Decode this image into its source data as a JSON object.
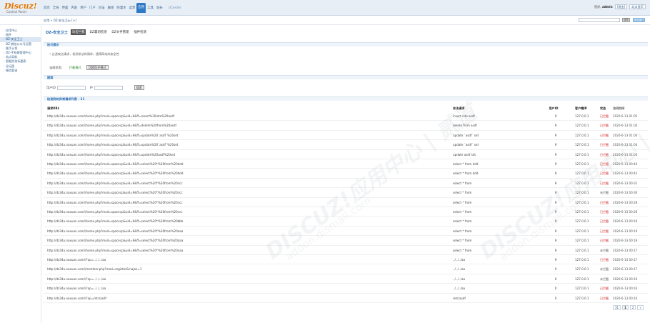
{
  "logo": {
    "main": "Discuz!",
    "sub": "Control Panel"
  },
  "nav": [
    "首页",
    "全局",
    "界面",
    "内容",
    "用户",
    "门户",
    "论坛",
    "群组",
    "防灌水",
    "运营",
    "应用",
    "工具",
    "站长",
    "UCenter"
  ],
  "nav_active_index": 10,
  "user": {
    "prefix": "您好,",
    "name": "admin",
    "logout": "[退出]",
    "home": "站点首页"
  },
  "breadcrumb": "应用 » DZ-安全卫士 [+]",
  "search": {
    "button": "搜索",
    "chip": "常用操作"
  },
  "sidebar": [
    "应用中心",
    "插件",
    "DZ-安全卫士",
    "DZ-微信公众号运营",
    "顺手认领",
    "DZ-手机微管理中心",
    "站点导航",
    "智能防伪标题表",
    "论坛图",
    "微信登录"
  ],
  "sidebar_active_index": 2,
  "page_title": "DZ-安全卫士",
  "tabs": [
    "攻击拦截",
    "DZ漏洞检测",
    "DZ文件管理",
    "插件检测"
  ],
  "tab_active_index": 0,
  "tips": {
    "header": "技巧提示",
    "text": "过滤攻击请求，检测非法的请求，提高网站的安全性"
  },
  "mode": {
    "label": "当前状态：",
    "value": "拦截模式",
    "button": "切换防护模式"
  },
  "filter": {
    "header": "搜索",
    "uid_label": "用户ID",
    "ip_label": "IP",
    "button": "搜索"
  },
  "list_header": "检测到的异常请求列表 - 31",
  "columns": {
    "url": "请求URL",
    "str": "非法请求",
    "uid": "用户ID",
    "ip": "客户端IP",
    "status": "状态",
    "time": "访问时间"
  },
  "rows": [
    {
      "url": "http://dz34u.naxuan.com//home.php?mod=spacecp&uid=9&ff=insert%20into%20asdf",
      "str": "insert into asdf",
      "uid": "9",
      "ip": "127.0.0.1",
      "status": "已拦截",
      "blocked": true,
      "time": "2020-6-13 01:05"
    },
    {
      "url": "http://dz34u.naxuan.com//home.php?mod=spacecp&uid=9&ff=delete%20from%20asdf",
      "str": "delete from asdf",
      "uid": "9",
      "ip": "127.0.0.1",
      "status": "已拦截",
      "blocked": true,
      "time": "2020-6-13 01:04"
    },
    {
      "url": "http://dz34u.naxuan.com//home.php?mod=spacecp&uid=9&ff=update%20`asdf`%20set",
      "str": "update `asdf` set",
      "uid": "9",
      "ip": "127.0.0.1",
      "status": "已拦截",
      "blocked": true,
      "time": "2020-6-13 01:04"
    },
    {
      "url": "http://dz34u.naxuan.com//home.php?mod=spacecp&uid=9&ff=update%20`asdf`%20set",
      "str": "update `asdf` set",
      "uid": "9",
      "ip": "127.0.0.1",
      "status": "已拦截",
      "blocked": true,
      "time": "2020-6-13 01:04"
    },
    {
      "url": "http://dz34u.naxuan.com//home.php?mod=spacecp&uid=9&ff=update%20asdf%20set",
      "str": "update asdf set",
      "uid": "9",
      "ip": "127.0.0.1",
      "status": "已拦截",
      "blocked": true,
      "time": "2020-6-13 01:04"
    },
    {
      "url": "http://dz34u.naxuan.com//home.php?mod=spacecp&uid=9&ff=select%20*%20from%20ddd",
      "str": "select * from ddd",
      "uid": "9",
      "ip": "127.0.0.1",
      "status": "已拦截",
      "blocked": true,
      "time": "2020-6-13 00:44"
    },
    {
      "url": "http://dz34u.naxuan.com//home.php?mod=spacecp&uid=9&ff=select%20*%20from%20ddd",
      "str": "select * from ddd",
      "uid": "9",
      "ip": "127.0.0.1",
      "status": "已拦截",
      "blocked": true,
      "time": "2020-6-13 00:43"
    },
    {
      "url": "http://dz34u.naxuan.com//home.php?mod=spacecp&uid=9&ff=select%20*%20from%20ccc",
      "str": "select * from",
      "uid": "9",
      "ip": "127.0.0.1",
      "status": "已拦截",
      "blocked": true,
      "time": "2020-6-13 00:31"
    },
    {
      "url": "http://dz34u.naxuan.com//home.php?mod=spacecp&uid=9&ff=select%20*%20from%20ccc",
      "str": "select * from",
      "uid": "9",
      "ip": "127.0.0.1",
      "status": "未拦截",
      "blocked": false,
      "time": "2020-6-13 00:30"
    },
    {
      "url": "http://dz34u.naxuan.com//home.php?mod=spacecp&uid=9&ff=select%20*%20from%20ccc",
      "str": "select * from",
      "uid": "9",
      "ip": "127.0.0.1",
      "status": "已拦截",
      "blocked": true,
      "time": "2020-6-13 00:28"
    },
    {
      "url": "http://dz34u.naxuan.com//home.php?mod=spacecp&uid=9&ff=select%20*%20from%20ccc",
      "str": "select * from",
      "uid": "9",
      "ip": "127.0.0.1",
      "status": "已拦截",
      "blocked": true,
      "time": "2020-6-13 00:26"
    },
    {
      "url": "http://dz34u.naxuan.com//home.php?mod=spacecp&uid=9&ff=select%20*%20from%20bbb",
      "str": "select * from",
      "uid": "9",
      "ip": "127.0.0.1",
      "status": "已拦截",
      "blocked": true,
      "time": "2020-6-13 00:19"
    },
    {
      "url": "http://dz34u.naxuan.com//home.php?mod=spacecp&uid=9&ff=select%20*%20from%20aaa",
      "str": "select * from",
      "uid": "9",
      "ip": "127.0.0.1",
      "status": "已拦截",
      "blocked": true,
      "time": "2020-6-13 00:19"
    },
    {
      "url": "http://dz34u.naxuan.com//home.php?mod=spacecp&uid=9&ff=select%20*%20from%20aaa",
      "str": "select * from",
      "uid": "9",
      "ip": "127.0.0.1",
      "status": "已拦截",
      "blocked": true,
      "time": "2020-6-13 00:18"
    },
    {
      "url": "http://dz34u.naxuan.com//home.php?mod=spacecp&uid=9&ff=select%20*%20from%20aaa",
      "str": "select * from",
      "uid": "9",
      "ip": "127.0.0.1",
      "status": "未拦截",
      "blocked": false,
      "time": "2020-6-13 00:17"
    },
    {
      "url": "http://dz34u.naxuan.com//?op=../../../aa",
      "str": "../../../aa",
      "uid": "9",
      "ip": "127.0.0.1",
      "status": "已拦截",
      "blocked": true,
      "time": "2020-6-13 00:17"
    },
    {
      "url": "http://dz34u.naxuan.com//member.php?mod=register&inajax=1",
      "str": "../../../aa",
      "uid": "0",
      "ip": "127.0.0.1",
      "status": "未拦截",
      "blocked": false,
      "time": "2020-6-13 00:17"
    },
    {
      "url": "http://dz34u.naxuan.com//?op=../../../aa",
      "str": "../../../aa",
      "uid": "0",
      "ip": "127.0.0.1",
      "status": "未拦截",
      "blocked": false,
      "time": "2020-6-13 00:16"
    },
    {
      "url": "http://dz34u.naxuan.com//?op=../../../aa",
      "str": "../../../aa",
      "uid": "0",
      "ip": "127.0.0.1",
      "status": "已拦截",
      "blocked": true,
      "time": "2020-6-13 00:16"
    },
    {
      "url": "http://dz34u.naxuan.com//?op=/etc/asdf",
      "str": "/etc/asdf",
      "uid": "0",
      "ip": "127.0.0.1",
      "status": "已拦截",
      "blocked": true,
      "time": "2020-6-13 00:16"
    }
  ],
  "pager": [
    "31",
    "1",
    "2",
    "»"
  ],
  "pager_current_index": 1,
  "watermark": {
    "main": "DISCUZ!应用中心 | 贰道",
    "sub": "addon.dismall.com"
  },
  "colors": {
    "accent": "#2f79c5",
    "blocked": "#d02020",
    "mode_on": "#2f8c2f",
    "logo": "#e77800"
  }
}
